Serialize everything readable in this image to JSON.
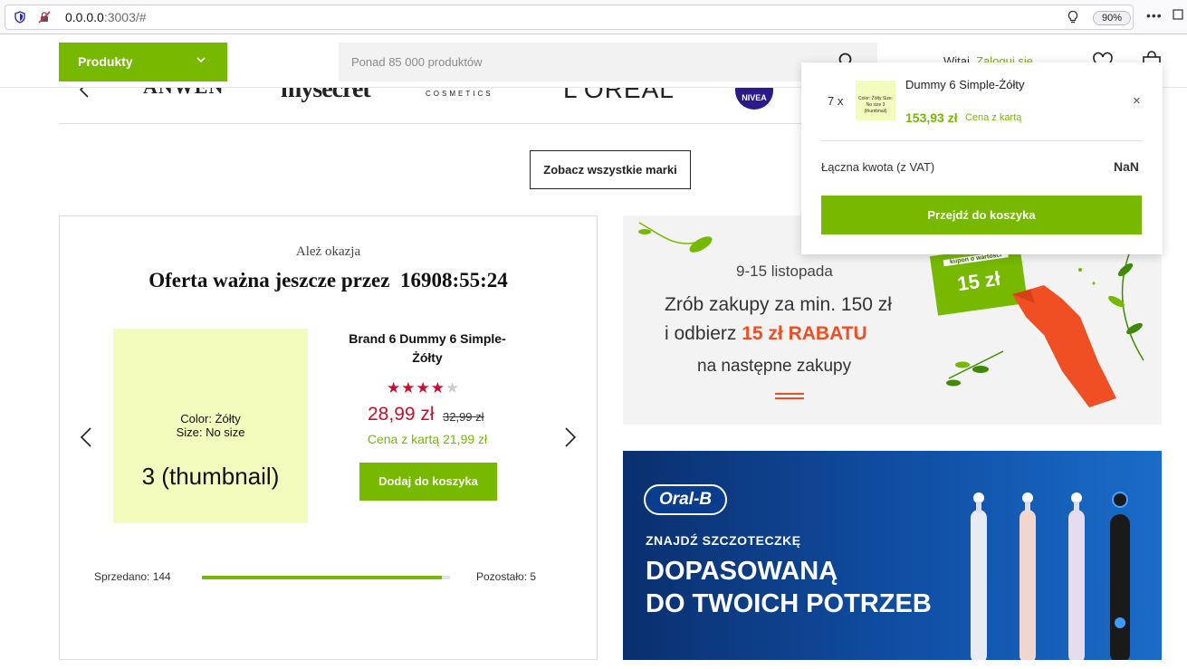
{
  "browser": {
    "url_host": "0.0.0.0",
    "url_rest": ":3003/#",
    "zoom": "90%",
    "more": "•••"
  },
  "header": {
    "products_label": "Produkty",
    "search_placeholder": "Ponad 85 000 produktów",
    "greeting": "Witaj,",
    "login_label": "Zaloguj się"
  },
  "brands": {
    "items": [
      "ANWEN",
      "mysecret",
      "COSMETICS",
      "L'OREAL",
      "NIVEA"
    ],
    "all_brands_label": "Zobacz wszystkie marki"
  },
  "deal": {
    "eyebrow": "Ależ okazja",
    "headline": "Oferta ważna jeszcze przez",
    "countdown": "16908:55:24",
    "thumb_color": "Color: Żółty",
    "thumb_size": "Size: No size",
    "thumb_label": "3 (thumbnail)",
    "product_name": "Brand 6 Dummy 6 Simple-Żółty",
    "rating": 4,
    "rating_max": 5,
    "price": "28,99 zł",
    "old_price": "32,99 zł",
    "card_price": "Cena z kartą 21,99 zł",
    "add_to_cart": "Dodaj do koszyka",
    "sold_label": "Sprzedano: 144",
    "left_label": "Pozostało: 5",
    "sold_fraction": 0.966
  },
  "promo1": {
    "dates": "9-15 listopada",
    "line2": "Zrób zakupy za min. 150 zł",
    "line3_prefix": "i odbierz",
    "line3_highlight": "15 zł RABATU",
    "line4": "na następne zakupy",
    "coupon_caption": "kupon o wartości",
    "coupon_value": "15 zł",
    "accent": "#f04e23"
  },
  "promo2": {
    "logo": "Oral-B",
    "line1": "ZNAJDŹ SZCZOTECZKĘ",
    "line2": "DOPASOWANĄ",
    "line3": "DO TWOICH POTRZEB"
  },
  "minicart": {
    "qty": "7 x",
    "thumb_text": "Color: Żółty Size: No size 3 (thumbnail)",
    "item_name": "Dummy 6 Simple-Żółty",
    "item_price": "153,93 zł",
    "card_label": "Cena z kartą",
    "close": "×",
    "total_label": "Łączna kwota (z VAT)",
    "total_value": "NaN",
    "checkout_label": "Przejdź do koszyka"
  },
  "colors": {
    "brand_green": "#77b800",
    "price_red": "#c8102e",
    "thumb_yellow": "#f3fbbd"
  }
}
